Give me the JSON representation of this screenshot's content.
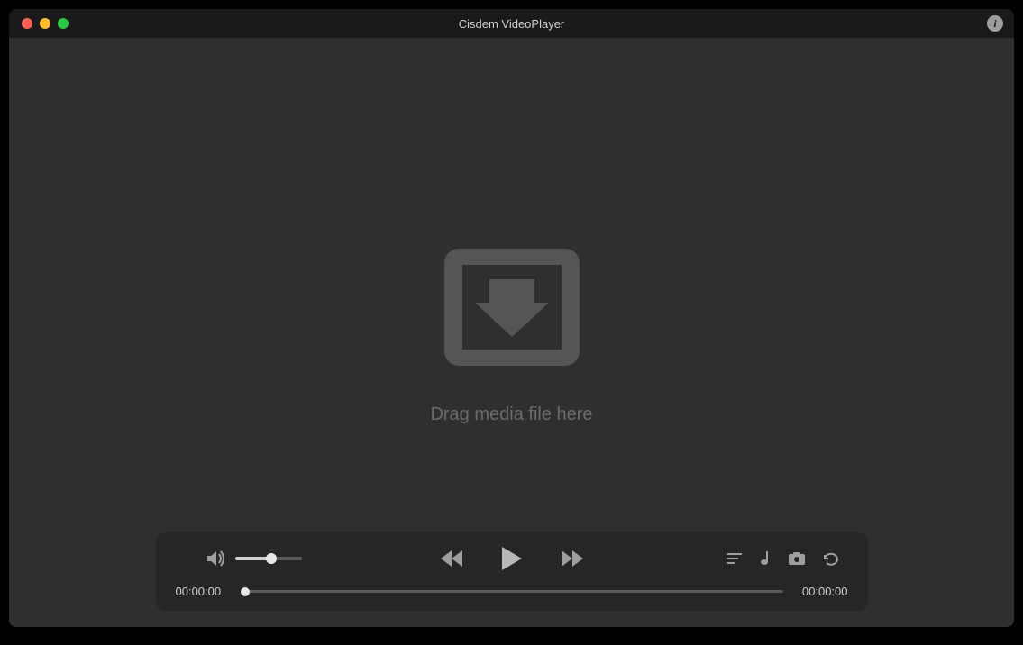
{
  "window": {
    "title": "Cisdem VideoPlayer"
  },
  "dropzone": {
    "text": "Drag media file here"
  },
  "playback": {
    "current_time": "00:00:00",
    "total_time": "00:00:00",
    "volume_percent": 55
  },
  "icons": {
    "info": "i"
  }
}
